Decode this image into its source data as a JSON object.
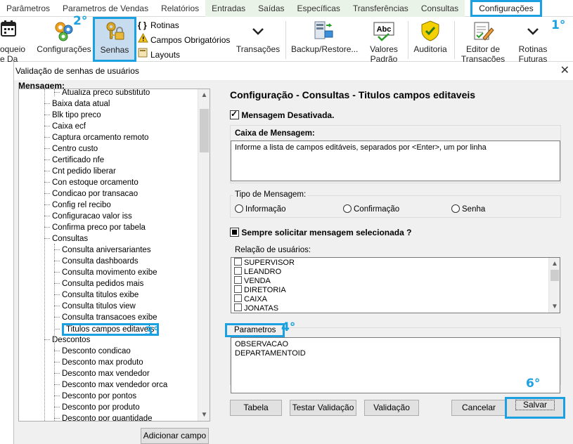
{
  "menu_tabs": [
    {
      "label": "Parâmetros",
      "style": "plain"
    },
    {
      "label": "Parametros de Vendas",
      "style": "plain"
    },
    {
      "label": "Relatórios",
      "style": "plain"
    },
    {
      "label": "Entradas",
      "style": "green"
    },
    {
      "label": "Saídas",
      "style": "green"
    },
    {
      "label": "Específicas",
      "style": "green"
    },
    {
      "label": "Transferências",
      "style": "green"
    },
    {
      "label": "Consultas",
      "style": "green"
    },
    {
      "label": "Configurações",
      "style": "active"
    }
  ],
  "ribbon": {
    "bloqueio_line1": "oqueio",
    "bloqueio_line2": "e Da",
    "configuracoes": "Configurações",
    "senhas": "Senhas",
    "rotinas": "Rotinas",
    "campos_obrigatorios": "Campos Obrigatórios",
    "layouts": "Layouts",
    "transacoes": "Transações",
    "backup_restore": "Backup/Restore...",
    "valores_padrao_line1": "Valores",
    "valores_padrao_line2": "Padrão",
    "auditoria": "Auditoria",
    "editor_line1": "Editor de",
    "editor_line2": "Transações",
    "rotinas_futuras_line1": "Rotinas",
    "rotinas_futuras_line2": "Futuras"
  },
  "callouts": {
    "one": "1°",
    "two": "2°",
    "three": "3°",
    "four": "4°",
    "six": "6°"
  },
  "dialog": {
    "title": "Validação de senhas de usuários",
    "close": "✕",
    "tree_header": "Mensagem:",
    "tree_items": [
      {
        "label": "Atualiza preco substituto",
        "level": 2
      },
      {
        "label": "Baixa data atual",
        "level": 1
      },
      {
        "label": "Blk tipo preco",
        "level": 1
      },
      {
        "label": "Caixa ecf",
        "level": 1
      },
      {
        "label": "Captura orcamento remoto",
        "level": 1
      },
      {
        "label": "Centro custo",
        "level": 1
      },
      {
        "label": "Certificado nfe",
        "level": 1
      },
      {
        "label": "Cnt pedido liberar",
        "level": 1
      },
      {
        "label": "Con estoque orcamento",
        "level": 1
      },
      {
        "label": "Condicao por transacao",
        "level": 1
      },
      {
        "label": "Config rel recibo",
        "level": 1
      },
      {
        "label": "Configuracao valor iss",
        "level": 1
      },
      {
        "label": "Confirma preco por tabela",
        "level": 1
      },
      {
        "label": "Consultas",
        "level": 1
      },
      {
        "label": "Consulta aniversariantes",
        "level": 2
      },
      {
        "label": "Consulta dashboards",
        "level": 2
      },
      {
        "label": "Consulta movimento exibe",
        "level": 2
      },
      {
        "label": "Consulta pedidos mais",
        "level": 2
      },
      {
        "label": "Consulta titulos exibe",
        "level": 2
      },
      {
        "label": "Consulta titulos view",
        "level": 2
      },
      {
        "label": "Consulta transacoes exibe",
        "level": 2
      },
      {
        "label": "Titulos campos editaveis",
        "level": 2,
        "selected": true
      },
      {
        "label": "Descontos",
        "level": 1
      },
      {
        "label": "Desconto condicao",
        "level": 2
      },
      {
        "label": "Desconto max produto",
        "level": 2
      },
      {
        "label": "Desconto max vendedor",
        "level": 2
      },
      {
        "label": "Desconto max vendedor orca",
        "level": 2
      },
      {
        "label": "Desconto por pontos",
        "level": 2
      },
      {
        "label": "Desconto por produto",
        "level": 2
      },
      {
        "label": "Desconto por quantidade",
        "level": 2
      }
    ],
    "add_button": "Adicionar campo",
    "config_title": "Configuração - Consultas - Titulos campos editaveis",
    "msg_desativada": "Mensagem Desativada.",
    "caixa_label": "Caixa de Mensagem:",
    "caixa_text": "Informe a lista de campos editáveis, separados por <Enter>, um por linha",
    "tipo_label": "Tipo de Mensagem:",
    "tipo_options": [
      "Informação",
      "Confirmação",
      "Senha"
    ],
    "sempre_solicitar": "Sempre solicitar mensagem selecionada ?",
    "relacao_label": "Relação de usuários:",
    "users": [
      "SUPERVISOR",
      "LEANDRO",
      "VENDA",
      "DIRETORIA",
      "CAIXA",
      "JONATAS"
    ],
    "parametros_label": "Parametros",
    "parametros": [
      "OBSERVACAO",
      "DEPARTAMENTOID"
    ],
    "buttons": {
      "tabela": "Tabela",
      "testar": "Testar Validação",
      "validacao": "Validação",
      "cancelar": "Cancelar",
      "salvar": "Salvar"
    }
  }
}
